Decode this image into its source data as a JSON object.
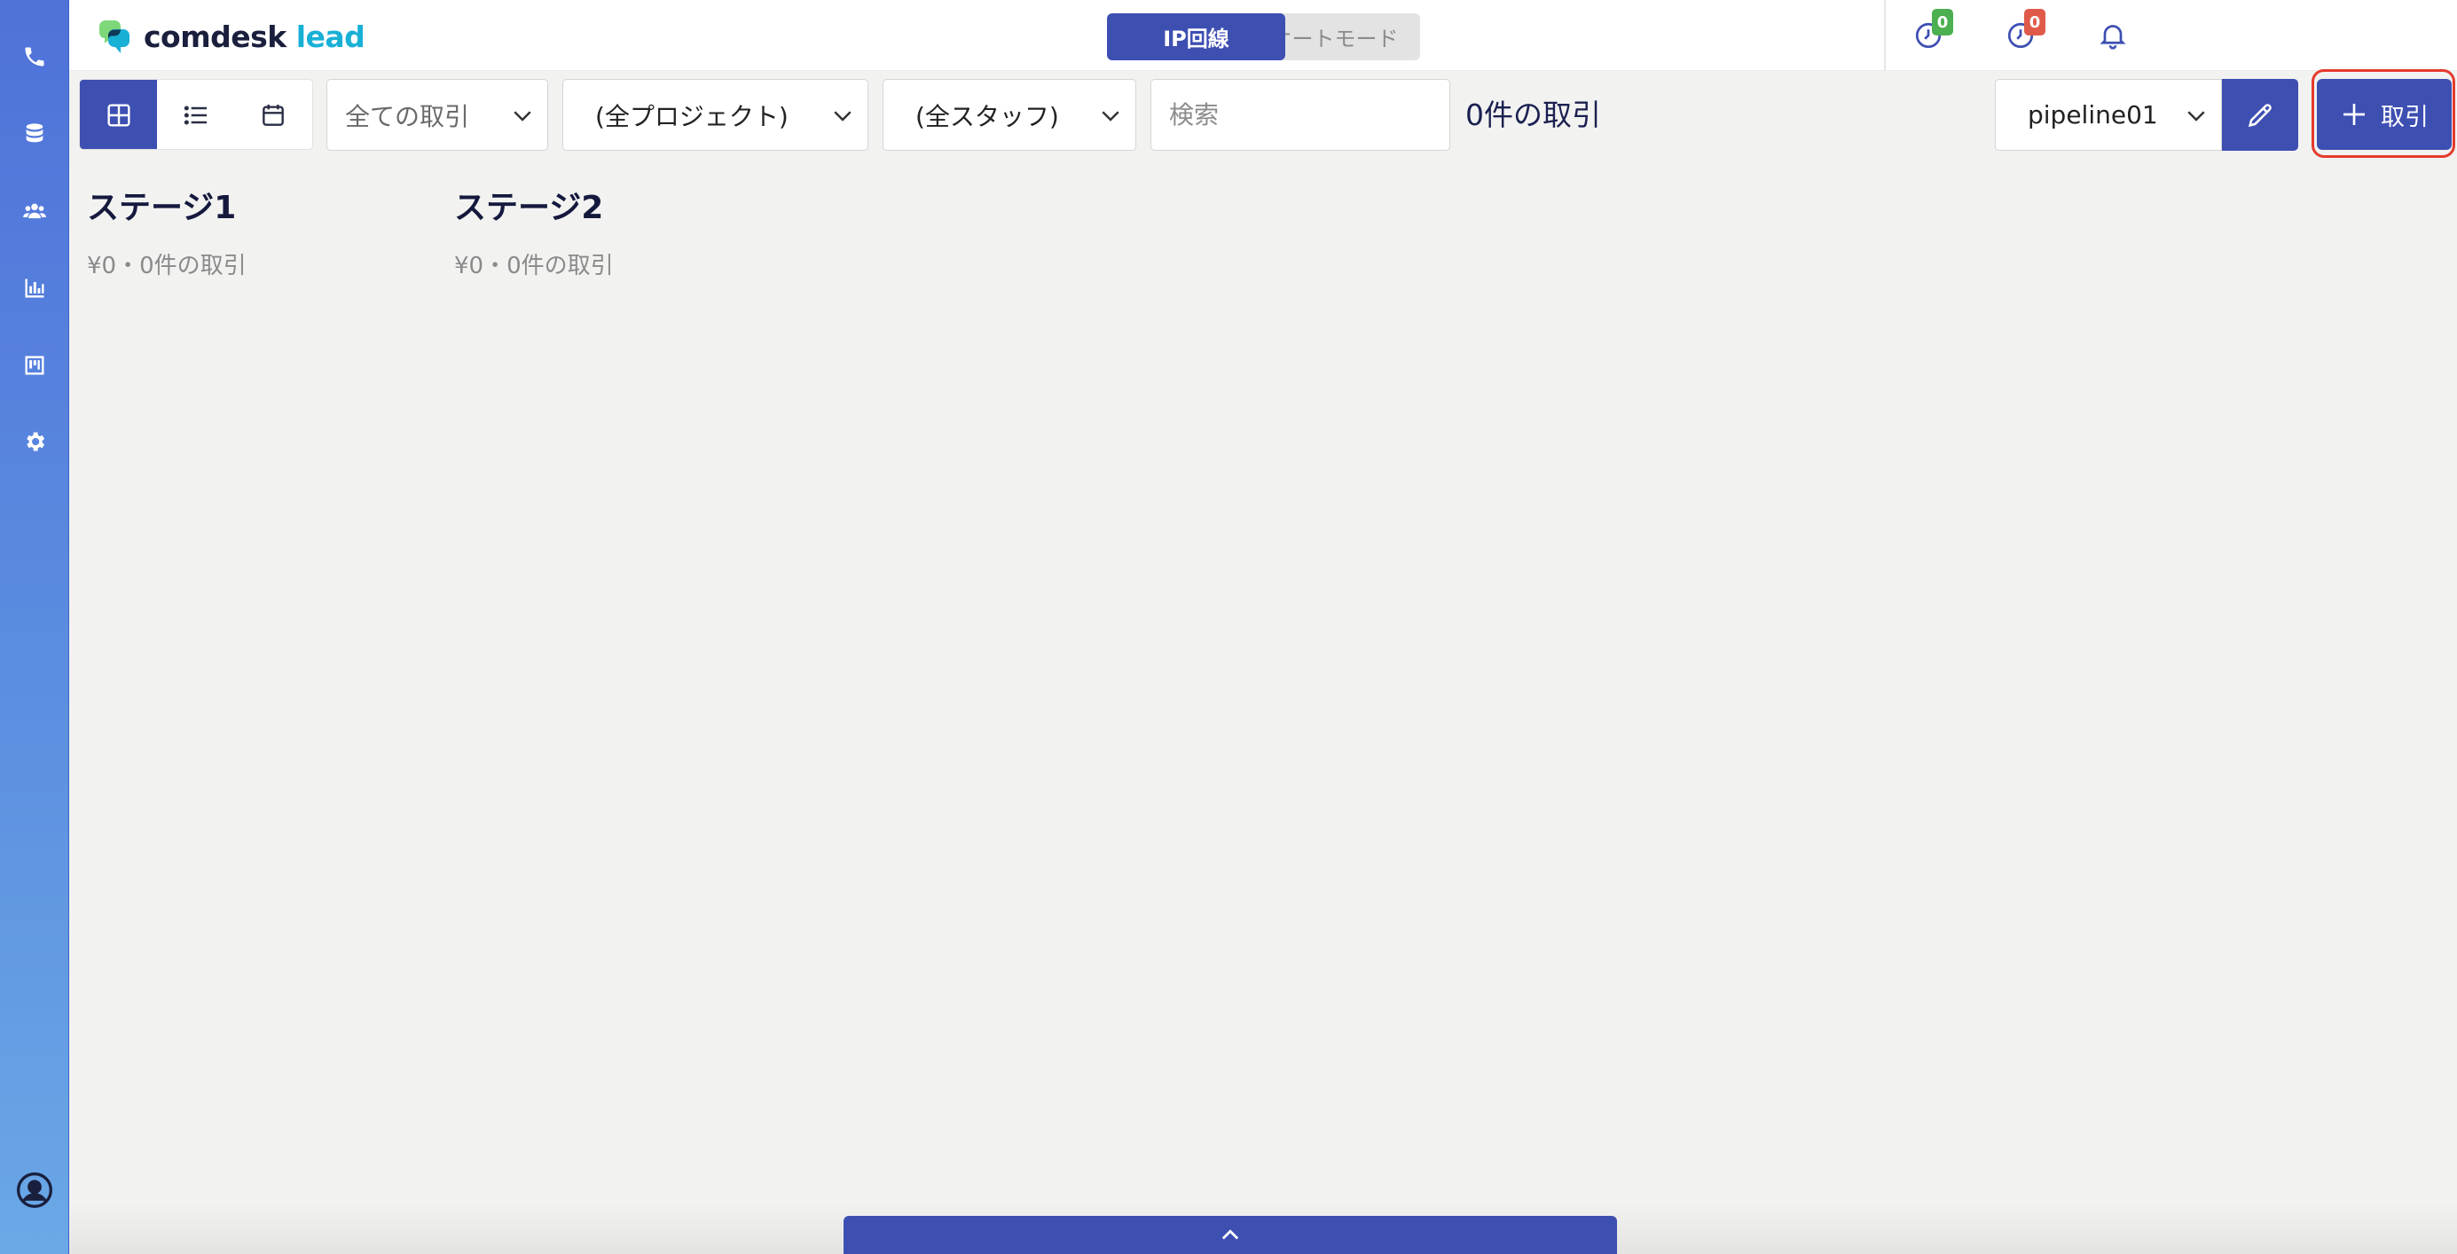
{
  "brand": {
    "name_part1": "comdesk",
    "name_part2": "lead",
    "accent": "#3e4fb2",
    "teal": "#19b0d6"
  },
  "sidebar": {
    "items": [
      {
        "icon": "phone-icon"
      },
      {
        "icon": "database-icon"
      },
      {
        "icon": "users-icon"
      },
      {
        "icon": "bar-chart-icon"
      },
      {
        "icon": "kanban-icon"
      },
      {
        "icon": "gear-icon"
      }
    ],
    "bottom_icon": "user-account-icon"
  },
  "header": {
    "mode_ip": "IP回線",
    "mode_auto": "オートモード",
    "clock_badge_1": "0",
    "clock_badge_2": "0",
    "icons": [
      "clock-icon",
      "clock-icon",
      "bell-icon"
    ]
  },
  "toolbar": {
    "views": [
      "board-view-icon",
      "list-view-icon",
      "calendar-view-icon"
    ],
    "active_view": "board",
    "deals_filter": "全ての取引",
    "project_filter": "(全プロジェクト)",
    "staff_filter": "(全スタッフ)",
    "search_placeholder": "検索",
    "deal_count": "0件の取引",
    "pipeline": "pipeline01",
    "add_label": "取引"
  },
  "board": {
    "stages": [
      {
        "name": "ステージ1",
        "summary": "¥0・0件の取引"
      },
      {
        "name": "ステージ2",
        "summary": "¥0・0件の取引"
      }
    ]
  }
}
